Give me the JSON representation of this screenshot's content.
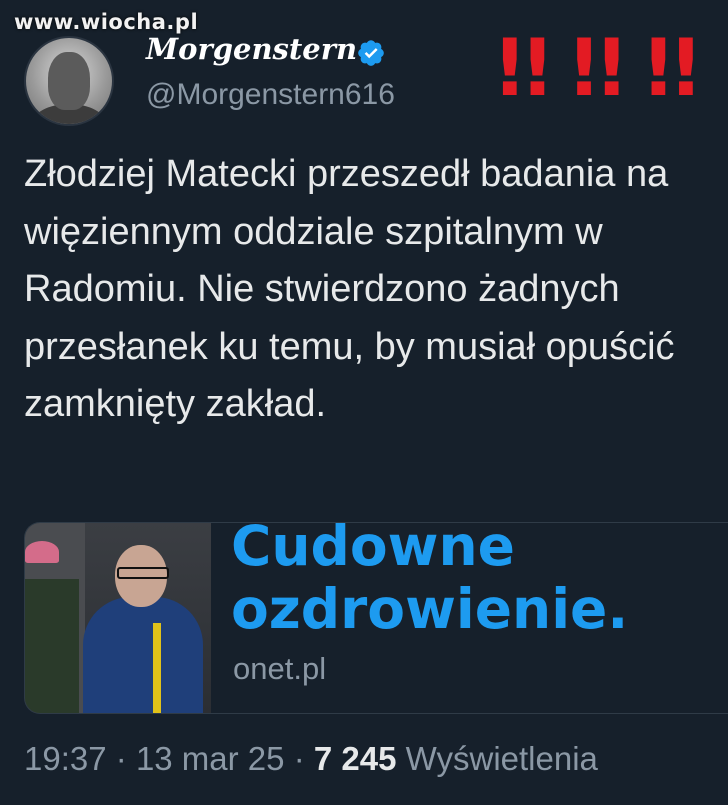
{
  "watermark": "www.wiocha.pl",
  "profile": {
    "display_name": "Morgenstern",
    "handle": "@Morgenstern616",
    "verified_icon": "verified-badge-icon",
    "badge_color": "#1d9bf0"
  },
  "annotation": {
    "exclamations": "!! !! !!",
    "color": "#e31b23"
  },
  "tweet": {
    "text": "Złodziej Matecki przeszedł badania na więziennym oddziale szpitalnym w Radomiu. Nie stwierdzono żadnych przesłanek ku temu, by musiał opuścić zamknięty zakład."
  },
  "card": {
    "headline_line1": "Cudowne",
    "headline_line2": "ozdrowienie.",
    "domain": "onet.pl",
    "headline_color": "#1d9bf0"
  },
  "meta": {
    "time": "19:37",
    "date": "13 mar 25",
    "separator": "·",
    "views_count": "7 245",
    "views_label": "Wyświetlenia"
  }
}
